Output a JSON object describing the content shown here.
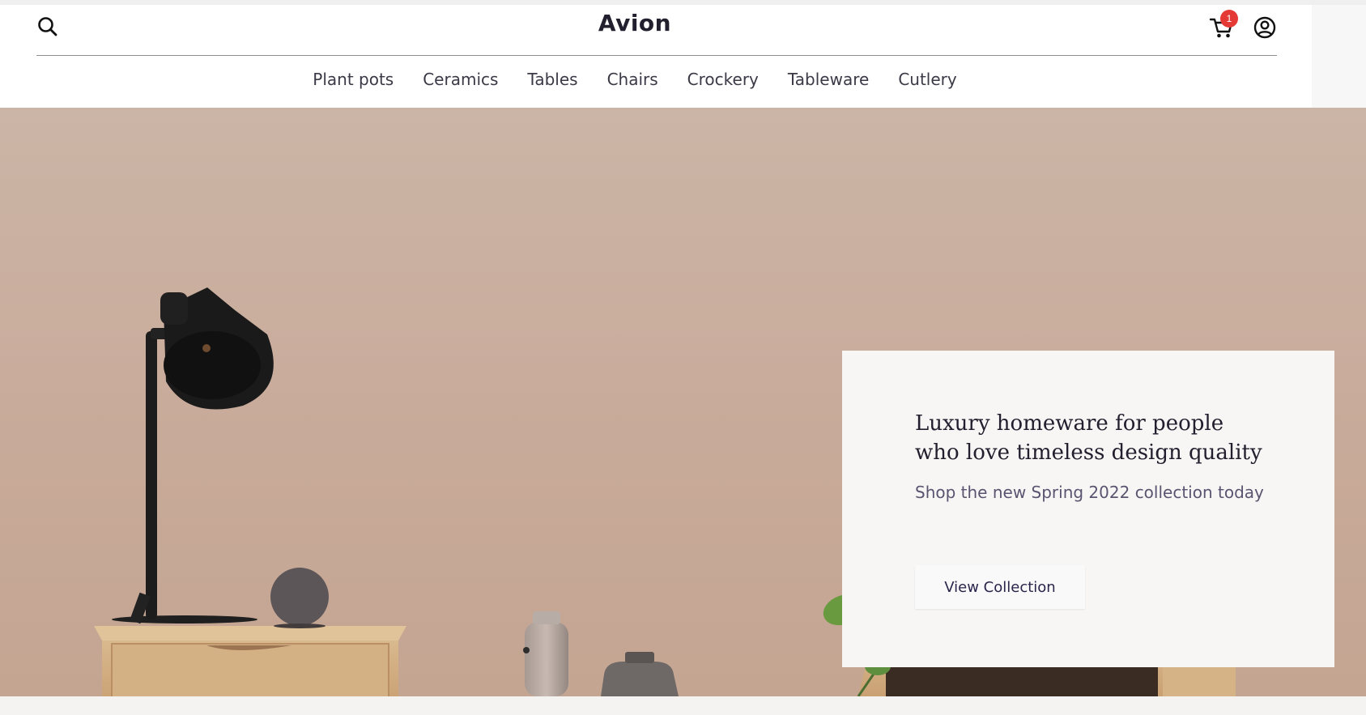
{
  "header": {
    "brand": "Avion",
    "cart_count": "1",
    "icons": [
      "search-icon",
      "cart-icon",
      "account-icon"
    ]
  },
  "nav": {
    "items": [
      {
        "label": "Plant pots"
      },
      {
        "label": "Ceramics"
      },
      {
        "label": "Tables"
      },
      {
        "label": "Chairs"
      },
      {
        "label": "Crockery"
      },
      {
        "label": "Tableware"
      },
      {
        "label": "Cutlery"
      }
    ]
  },
  "hero": {
    "headline_line1": "Luxury homeware for people",
    "headline_line2": "who love timeless design quality",
    "subheadline": "Shop the new Spring 2022 collection today",
    "cta_label": "View Collection"
  },
  "colors": {
    "background": "#cbb5a6",
    "card": "#f8f6f5",
    "text_dark": "#22202e",
    "badge": "#e53935"
  }
}
